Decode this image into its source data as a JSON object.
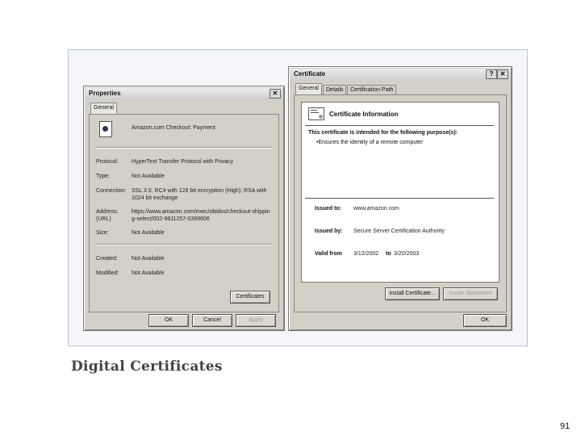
{
  "properties": {
    "title": "Properties",
    "close": "✕",
    "tab": "General",
    "page_title": "Amazon.com Checkout: Payment",
    "fields": [
      {
        "label": "Protocol:",
        "value": "HyperText Transfer Protocol with Privacy"
      },
      {
        "label": "Type:",
        "value": "Not Available"
      },
      {
        "label": "Connection:",
        "value": "SSL 3.0, RC4 with 128 bit encryption (High); RSA with 1024 bit exchange"
      },
      {
        "label": "Address: (URL)",
        "value": "https://www.amazon.com/exec/obidos/checkout-shipping-select/002-9811257-0369606"
      },
      {
        "label": "Size:",
        "value": "Not Available"
      },
      {
        "label": "Created:",
        "value": "Not Available"
      },
      {
        "label": "Modified:",
        "value": "Not Available"
      }
    ],
    "certificates_button": "Certificates",
    "ok": "OK",
    "cancel": "Cancel",
    "apply": "Apply"
  },
  "certificate": {
    "title": "Certificate",
    "help": "?",
    "close": "✕",
    "tabs": [
      "General",
      "Details",
      "Certification Path"
    ],
    "info_heading": "Certificate Information",
    "purpose_heading": "This certificate is intended for the following purpose(s):",
    "purpose_item": "•Ensures the identity of a remote computer",
    "issued_to_label": "Issued to:",
    "issued_to_value": "www.amazon.com",
    "issued_by_label": "Issued by:",
    "issued_by_value": "Secure Server Certification Authority",
    "valid_from_label": "Valid from",
    "valid_from_value": "3/12/2002",
    "valid_to_label": "to",
    "valid_to_value": "3/20/2003",
    "install_button": "Install Certificate...",
    "issuer_button": "Issuer Statement",
    "ok": "OK"
  },
  "caption": "Digital Certificates",
  "page_number": "91"
}
